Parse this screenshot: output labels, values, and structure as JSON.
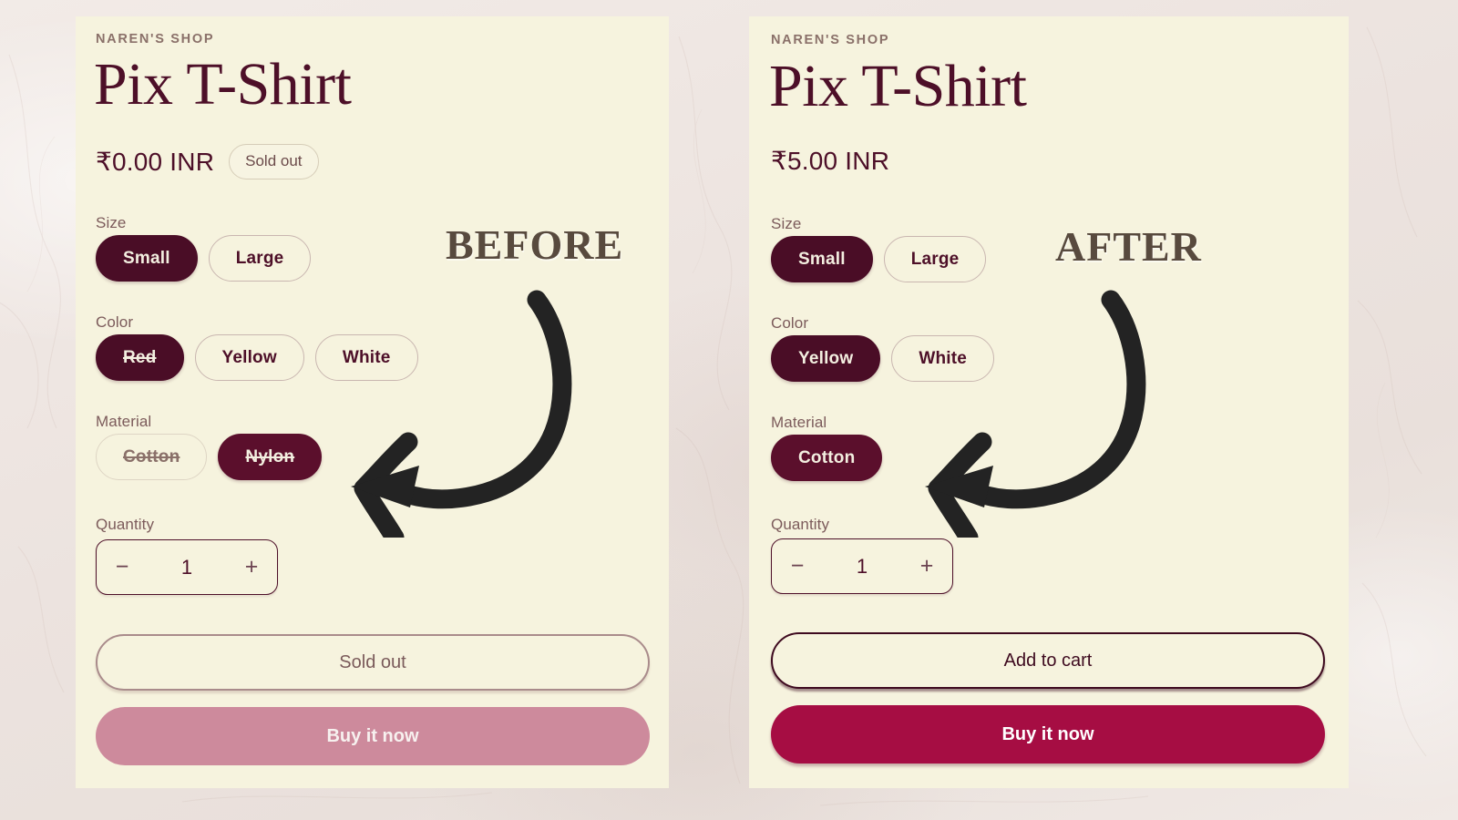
{
  "page": {
    "background_color": "#ece4e0",
    "card_color": "#f6f3de",
    "accent_dark": "#4d0f28",
    "accent_selected": "#4a0d26",
    "accent_primary": "#a60d43",
    "accent_primary_disabled": "#cd8a9c",
    "annotation_color": "#584a3e"
  },
  "annotations": {
    "before_label": "BEFORE",
    "after_label": "AFTER",
    "before_arrow": "curved-arrow-left-icon",
    "after_arrow": "curved-arrow-left-icon"
  },
  "before": {
    "vendor": "NAREN'S SHOP",
    "title": "Pix T-Shirt",
    "price": "₹0.00 INR",
    "availability_badge": "Sold out",
    "options": [
      {
        "label": "Size",
        "values": [
          {
            "text": "Small",
            "selected": true,
            "strikethrough": false
          },
          {
            "text": "Large",
            "selected": false,
            "strikethrough": false
          }
        ]
      },
      {
        "label": "Color",
        "values": [
          {
            "text": "Red",
            "selected": true,
            "strikethrough": true
          },
          {
            "text": "Yellow",
            "selected": false,
            "strikethrough": false
          },
          {
            "text": "White",
            "selected": false,
            "strikethrough": false
          }
        ]
      },
      {
        "label": "Material",
        "values": [
          {
            "text": "Cotton",
            "selected": false,
            "strikethrough": true
          },
          {
            "text": "Nylon",
            "selected": true,
            "strikethrough": true
          }
        ]
      }
    ],
    "quantity": {
      "label": "Quantity",
      "decrement_icon": "minus-icon",
      "increment_icon": "plus-icon",
      "value": "1"
    },
    "actions": {
      "cart_label": "Sold out",
      "cart_enabled": false,
      "buy_label": "Buy it now",
      "buy_enabled": false
    }
  },
  "after": {
    "vendor": "NAREN'S SHOP",
    "title": "Pix T-Shirt",
    "price": "₹5.00 INR",
    "availability_badge": "",
    "options": [
      {
        "label": "Size",
        "values": [
          {
            "text": "Small",
            "selected": true,
            "strikethrough": false
          },
          {
            "text": "Large",
            "selected": false,
            "strikethrough": false
          }
        ]
      },
      {
        "label": "Color",
        "values": [
          {
            "text": "Yellow",
            "selected": true,
            "strikethrough": false
          },
          {
            "text": "White",
            "selected": false,
            "strikethrough": false
          }
        ]
      },
      {
        "label": "Material",
        "values": [
          {
            "text": "Cotton",
            "selected": true,
            "strikethrough": false
          }
        ]
      }
    ],
    "quantity": {
      "label": "Quantity",
      "decrement_icon": "minus-icon",
      "increment_icon": "plus-icon",
      "value": "1"
    },
    "actions": {
      "cart_label": "Add to cart",
      "cart_enabled": true,
      "buy_label": "Buy it now",
      "buy_enabled": true
    }
  }
}
